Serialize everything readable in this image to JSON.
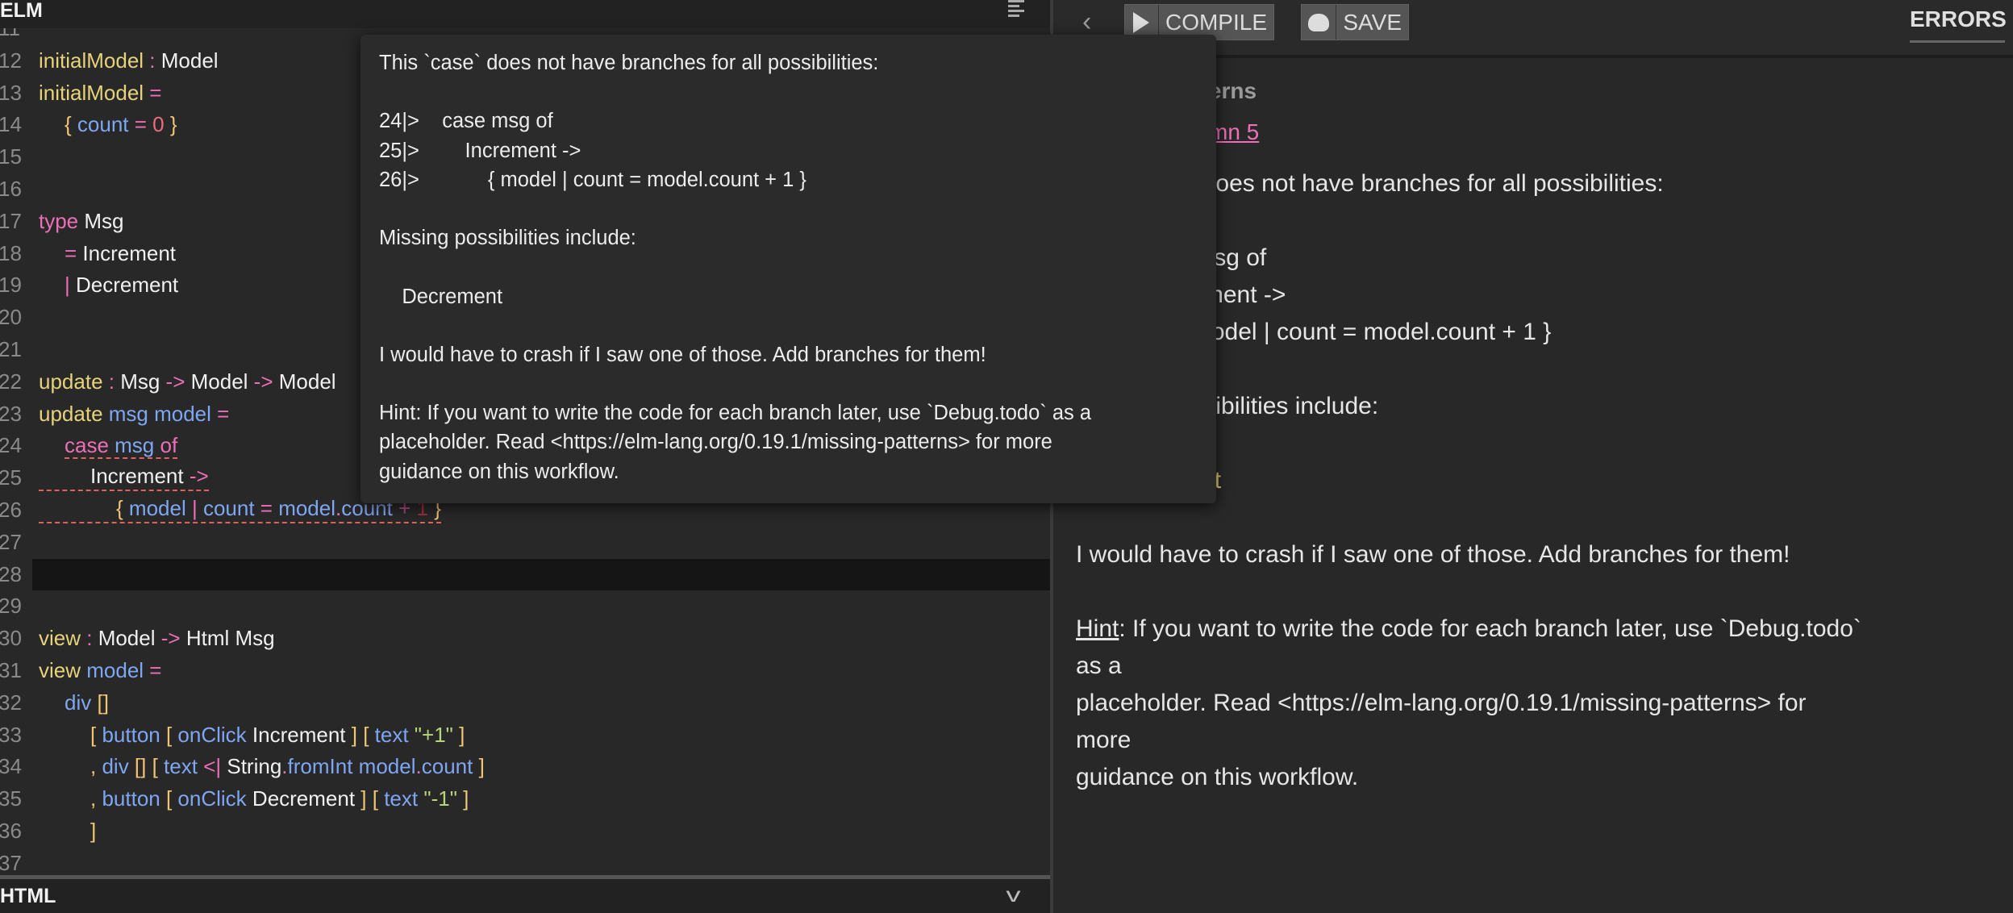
{
  "editor": {
    "title": "ELM",
    "current_line": 28,
    "lines": [
      {
        "n": "11",
        "indent": 0,
        "tokens": []
      },
      {
        "n": "12",
        "indent": 0,
        "tokens": [
          [
            "initialModel",
            "def"
          ],
          [
            " :",
            "op"
          ],
          [
            " Model",
            "type"
          ]
        ]
      },
      {
        "n": "13",
        "indent": 0,
        "tokens": [
          [
            "initialModel",
            "def"
          ],
          [
            " =",
            "op"
          ]
        ]
      },
      {
        "n": "14",
        "indent": 1,
        "tokens": [
          [
            "{",
            "br"
          ],
          [
            " count",
            "var"
          ],
          [
            " =",
            "op"
          ],
          [
            " 0",
            "num"
          ],
          [
            " }",
            "br"
          ]
        ]
      },
      {
        "n": "15",
        "indent": 0,
        "tokens": []
      },
      {
        "n": "16",
        "indent": 0,
        "tokens": []
      },
      {
        "n": "17",
        "indent": 0,
        "tokens": [
          [
            "type",
            "kw"
          ],
          [
            " Msg",
            "type"
          ]
        ]
      },
      {
        "n": "18",
        "indent": 1,
        "tokens": [
          [
            "=",
            "op"
          ],
          [
            " Increment",
            "type"
          ]
        ]
      },
      {
        "n": "19",
        "indent": 1,
        "tokens": [
          [
            "|",
            "op"
          ],
          [
            " Decrement",
            "type"
          ]
        ]
      },
      {
        "n": "20",
        "indent": 0,
        "tokens": []
      },
      {
        "n": "21",
        "indent": 0,
        "tokens": []
      },
      {
        "n": "22",
        "indent": 0,
        "tokens": [
          [
            "update",
            "def"
          ],
          [
            " :",
            "op"
          ],
          [
            " Msg",
            "type"
          ],
          [
            " ->",
            "op"
          ],
          [
            " Model",
            "type"
          ],
          [
            " ->",
            "op"
          ],
          [
            " Model",
            "type"
          ]
        ]
      },
      {
        "n": "23",
        "indent": 0,
        "tokens": [
          [
            "update",
            "def"
          ],
          [
            " msg model",
            "var"
          ],
          [
            " =",
            "op"
          ]
        ]
      },
      {
        "n": "24",
        "indent": 1,
        "error_underline": "text",
        "tokens": [
          [
            "case",
            "kw"
          ],
          [
            " msg",
            "var"
          ],
          [
            " of",
            "kw"
          ]
        ]
      },
      {
        "n": "25",
        "indent": 2,
        "error_underline": "line",
        "tokens": [
          [
            "Increment",
            "type"
          ],
          [
            " ->",
            "op"
          ]
        ]
      },
      {
        "n": "26",
        "indent": 3,
        "error_underline": "line",
        "tokens": [
          [
            "{",
            "br"
          ],
          [
            " model",
            "var"
          ],
          [
            " |",
            "op"
          ],
          [
            " count",
            "var"
          ],
          [
            " =",
            "op"
          ],
          [
            " model",
            "var"
          ],
          [
            ".",
            "op"
          ],
          [
            "count",
            "var"
          ],
          [
            " +",
            "dimop"
          ],
          [
            " 1",
            "dimnum"
          ],
          [
            " }",
            "br"
          ]
        ]
      },
      {
        "n": "27",
        "indent": 0,
        "tokens": []
      },
      {
        "n": "28",
        "indent": 0,
        "tokens": []
      },
      {
        "n": "29",
        "indent": 0,
        "tokens": []
      },
      {
        "n": "30",
        "indent": 0,
        "tokens": [
          [
            "view",
            "def"
          ],
          [
            " :",
            "op"
          ],
          [
            " Model",
            "type"
          ],
          [
            " ->",
            "op"
          ],
          [
            " Html Msg",
            "type"
          ]
        ]
      },
      {
        "n": "31",
        "indent": 0,
        "tokens": [
          [
            "view",
            "def"
          ],
          [
            " model",
            "var"
          ],
          [
            " =",
            "op"
          ]
        ]
      },
      {
        "n": "32",
        "indent": 1,
        "tokens": [
          [
            "div",
            "var"
          ],
          [
            " []",
            "br"
          ]
        ]
      },
      {
        "n": "33",
        "indent": 2,
        "tokens": [
          [
            "[",
            "br"
          ],
          [
            " button",
            "var"
          ],
          [
            " [",
            "br"
          ],
          [
            " onClick",
            "var"
          ],
          [
            " Increment",
            "type"
          ],
          [
            " ]",
            "br"
          ],
          [
            " [",
            "br"
          ],
          [
            " text",
            "var"
          ],
          [
            " \"+1\"",
            "str"
          ],
          [
            " ]",
            "br"
          ]
        ]
      },
      {
        "n": "34",
        "indent": 2,
        "tokens": [
          [
            ",",
            "br"
          ],
          [
            " div",
            "var"
          ],
          [
            " []",
            "br"
          ],
          [
            " [",
            "br"
          ],
          [
            " text",
            "var"
          ],
          [
            " <|",
            "op"
          ],
          [
            " String",
            "type"
          ],
          [
            ".",
            "op"
          ],
          [
            "fromInt",
            "var"
          ],
          [
            " model",
            "var"
          ],
          [
            ".",
            "op"
          ],
          [
            "count",
            "var"
          ],
          [
            " ]",
            "br"
          ]
        ]
      },
      {
        "n": "35",
        "indent": 2,
        "tokens": [
          [
            ",",
            "br"
          ],
          [
            " button",
            "var"
          ],
          [
            " [",
            "br"
          ],
          [
            " onClick",
            "var"
          ],
          [
            " Decrement",
            "type"
          ],
          [
            " ]",
            "br"
          ],
          [
            " [",
            "br"
          ],
          [
            " text",
            "var"
          ],
          [
            " \"-1\"",
            "str"
          ],
          [
            " ]",
            "br"
          ]
        ]
      },
      {
        "n": "36",
        "indent": 2,
        "tokens": [
          [
            "]",
            "br"
          ]
        ]
      },
      {
        "n": "37",
        "indent": 0,
        "tokens": []
      }
    ]
  },
  "html_panel": {
    "title": "HTML"
  },
  "toolbar": {
    "compile_label": "COMPILE",
    "save_label": "SAVE",
    "errors_tab": "ERRORS"
  },
  "errors": {
    "title": "Missing Patterns",
    "location": "Line 24, Column 5",
    "body": [
      {
        "text": "This `case` does not have branches for all possibilities:"
      },
      {
        "text": ""
      },
      {
        "text": "24|    case msg of"
      },
      {
        "text": "25|      Increment ->"
      },
      {
        "text": "26|          { model | count = model.count + 1 }"
      },
      {
        "text": ""
      },
      {
        "text": "Missing possibilities include:"
      },
      {
        "text": ""
      },
      {
        "text": "    Decrement",
        "style": "y"
      },
      {
        "text": ""
      },
      {
        "text": "I would have to crash if I saw one of those. Add branches for them!"
      },
      {
        "text": ""
      },
      {
        "hint_label": "Hint",
        "text": ": If you want to write the code for each branch later, use `Debug.todo`"
      },
      {
        "text": "as a"
      },
      {
        "text": "placeholder. Read <https://elm-lang.org/0.19.1/missing-patterns> for"
      },
      {
        "text": "more"
      },
      {
        "text": "guidance on this workflow."
      }
    ]
  },
  "tooltip": {
    "lines": [
      "This `case` does not have branches for all possibilities:",
      "",
      "24|>    case msg of",
      "25|>        Increment ->",
      "26|>            { model | count = model.count + 1 }",
      "",
      "Missing possibilities include:",
      "",
      "    Decrement",
      "",
      "I would have to crash if I saw one of those. Add branches for them!",
      "",
      "Hint: If you want to write the code for each branch later, use `Debug.todo` as a",
      "placeholder. Read <https://elm-lang.org/0.19.1/missing-patterns> for more",
      "guidance on this workflow."
    ]
  },
  "colors": {
    "background": "#282828",
    "keyword": "#ec6fb8",
    "definition": "#e6d27a",
    "variable": "#7fa6f2",
    "error_underline": "#e06060"
  }
}
